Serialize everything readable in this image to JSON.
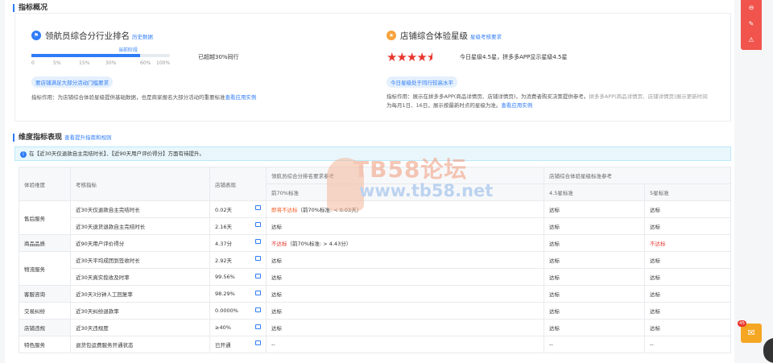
{
  "overview": {
    "title": "指标概况",
    "navigator": {
      "title": "领航员综合分行业排名",
      "link": "历史数据",
      "current_tag": "当前阶段",
      "ticks": [
        "0",
        "5%",
        "15%",
        "30%",
        "60%",
        "100%"
      ],
      "progress_percent": 60,
      "summary": "已超越30%同行",
      "pill": "要店铺满足大部分活动门槛要求",
      "desc_prefix": "指标作用：为店铺综合体验星级提供基础数据，也是商家报名大部分活动的重要标准",
      "desc_link": "查看应用实例"
    },
    "store": {
      "title": "店铺综合体验星级",
      "link": "星级考核要求",
      "stars_value": 4.5,
      "star_glyphs": [
        "★",
        "★",
        "★",
        "★",
        "★"
      ],
      "summary": "今日星级4.5星，拼多多APP显示星级4.5星",
      "pill": "今日星级处于同行较高水平",
      "desc_line1": "指标作用：展示在拼多多APP(商品详情页、店铺详情页)，为消费者购买决策提供参考。",
      "desc_line1_muted": "拼多多APP(商品详情页、店铺详情页)展示更新时间",
      "desc_line2": "为每月1日、16日，展示按最新时点的星级为准。",
      "desc_link": "查看应用实例"
    }
  },
  "dimension": {
    "title": "维度指标表现",
    "link": "查看提升指南和规则",
    "notice": "在【近30天仅退款自主完结时长】、【近90天用户评价得分】方面有待提升。",
    "headers": {
      "dimension": "体验维度",
      "metric": "考核指标",
      "store_perf": "店铺表现",
      "navigator_group": "领航员综合分排名要求参考",
      "navigator_sub": "前70%标准",
      "star_group": "店铺综合体验星级标准参考",
      "star45": "4.5星标准",
      "star5": "5星标准"
    },
    "rows": [
      {
        "cat": "售后服务",
        "metric": "近30天仅退款自主完结时长",
        "value": "0.02天",
        "nav": "即将不达标",
        "nav_note": "（前70%标准: < 0.03天）",
        "s45": "达标",
        "s5": "达标"
      },
      {
        "cat": "",
        "metric": "近30天退货退款自主完结时长",
        "value": "2.16天",
        "nav": "达标",
        "nav_note": "",
        "s45": "达标",
        "s5": "达标"
      },
      {
        "cat": "商品品质",
        "metric": "近90天用户评价得分",
        "value": "4.37分",
        "nav": "不达标",
        "nav_note": "（前70%标准: > 4.43分）",
        "s45": "达标",
        "s5": "不达标"
      },
      {
        "cat": "物流服务",
        "metric": "近30天平均成团到签收时长",
        "value": "2.92天",
        "nav": "达标",
        "nav_note": "",
        "s45": "达标",
        "s5": "达标"
      },
      {
        "cat": "",
        "metric": "近30天真实揽收及时率",
        "value": "99.56%",
        "nav": "达标",
        "nav_note": "",
        "s45": "达标",
        "s5": "达标"
      },
      {
        "cat": "客服咨询",
        "metric": "近30天3分钟人工回复率",
        "value": "98.29%",
        "nav": "达标",
        "nav_note": "",
        "s45": "达标",
        "s5": "达标"
      },
      {
        "cat": "交易纠纷",
        "metric": "近30天纠纷退款率",
        "value": "0.0000%",
        "nav": "达标",
        "nav_note": "",
        "s45": "达标",
        "s5": "达标"
      },
      {
        "cat": "店铺违规",
        "metric": "近30天违规度",
        "value": "≥40%",
        "nav": "达标",
        "nav_note": "",
        "s45": "达标",
        "s5": "达标"
      },
      {
        "cat": "特色服务",
        "metric": "退货包运费服务开通状态",
        "value": "已开通",
        "nav": "--",
        "nav_note": "",
        "s45": "--",
        "s5": "--"
      }
    ]
  },
  "watermark": {
    "line1": "TB58论坛",
    "line2": "www.tb58.net"
  },
  "side": {
    "badge": "45",
    "icons": [
      "minus-circle-icon",
      "edit-icon",
      "warning-icon",
      "mail-icon"
    ]
  },
  "colors": {
    "accent": "#2f7cf6",
    "bad": "#e8372e",
    "warn": "#f55a22",
    "star": "#e8372e"
  }
}
